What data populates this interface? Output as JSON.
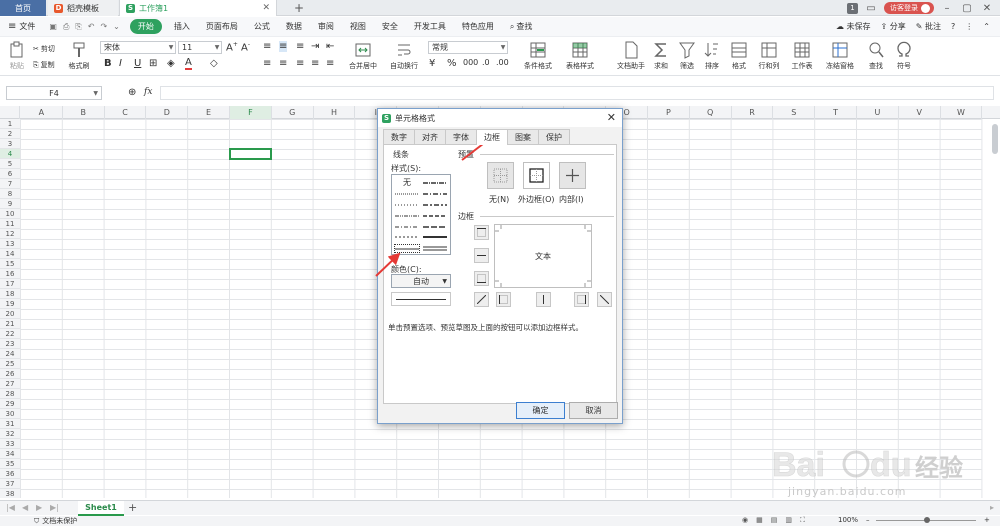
{
  "titlebar": {
    "tabs": [
      {
        "label": "首页"
      },
      {
        "label": "稻壳模板"
      },
      {
        "label": "工作簿1"
      }
    ],
    "badge": "1",
    "login": "访客登录"
  },
  "menu": {
    "file": "文件",
    "items": [
      "开始",
      "插入",
      "页面布局",
      "公式",
      "数据",
      "审阅",
      "视图",
      "安全",
      "开发工具",
      "特色应用"
    ],
    "search": "查找",
    "right": [
      "未保存",
      "分享",
      "批注"
    ]
  },
  "ribbon": {
    "paste": "粘贴",
    "cut": "剪切",
    "copy": "复制",
    "format_painter": "格式刷",
    "font_name": "宋体",
    "font_size": "11",
    "merge": "合并居中",
    "wrap": "自动换行",
    "number_format": "常规",
    "conditional": "条件格式",
    "table_style": "表格样式",
    "doc_assist": "文档助手",
    "sum": "求和",
    "filter": "筛选",
    "sort": "排序",
    "format": "格式",
    "rowcol": "行和列",
    "worksheet": "工作表",
    "freeze": "冻结窗格",
    "find": "查找",
    "symbol": "符号"
  },
  "formula_bar": {
    "cell_ref": "F4",
    "fx": "fx"
  },
  "grid": {
    "columns": [
      "A",
      "B",
      "C",
      "D",
      "E",
      "F",
      "G",
      "H",
      "I",
      "J",
      "K",
      "L",
      "M",
      "N",
      "O",
      "P",
      "Q",
      "R",
      "S",
      "T",
      "U",
      "V",
      "W"
    ],
    "rows": [
      "1",
      "2",
      "3",
      "4",
      "5",
      "6",
      "7",
      "8",
      "9",
      "10",
      "11",
      "12",
      "13",
      "14",
      "15",
      "16",
      "17",
      "18",
      "19",
      "20",
      "21",
      "22",
      "23",
      "24",
      "25",
      "26",
      "27",
      "28",
      "29",
      "30",
      "31",
      "32",
      "33",
      "34",
      "35",
      "36",
      "37",
      "38"
    ],
    "selected_cell": "F4"
  },
  "sheets": {
    "tabs": [
      "Sheet1"
    ]
  },
  "status": {
    "protect": "文档未保护",
    "zoom": "100%"
  },
  "dialog": {
    "title": "单元格格式",
    "tabs": [
      "数字",
      "对齐",
      "字体",
      "边框",
      "图案",
      "保护"
    ],
    "active_tab": "边框",
    "line_group": "线条",
    "style_label": "样式(S):",
    "style_none": "无",
    "color_label": "颜色(C):",
    "color_value": "自动",
    "preset_group": "预置",
    "presets": [
      "无(N)",
      "外边框(O)",
      "内部(I)"
    ],
    "border_group": "边框",
    "preview_text": "文本",
    "hint": "单击预置选项、预览草图及上面的按钮可以添加边框样式。",
    "ok": "确定",
    "cancel": "取消"
  },
  "watermark": {
    "brand_cn": "经验",
    "url": "jingyan.baidu.com"
  }
}
